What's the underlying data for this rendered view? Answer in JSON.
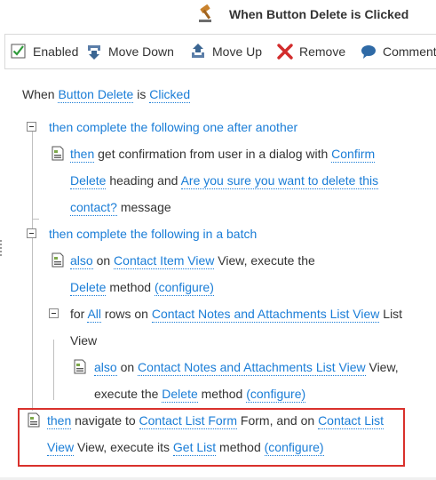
{
  "header": {
    "title": "When Button Delete is Clicked",
    "icon": "gavel-icon"
  },
  "toolbar": {
    "enabled_label": "Enabled",
    "move_down_label": "Move Down",
    "move_up_label": "Move Up",
    "remove_label": "Remove",
    "comment_label": "Comment"
  },
  "rule": {
    "when": {
      "prefix": "When",
      "control": "Button Delete",
      "is": "is",
      "event": "Clicked"
    },
    "seq_group": {
      "label": "then complete the following one after another"
    },
    "confirm": {
      "then": "then",
      "text1": "get confirmation from user in a dialog with",
      "heading_link_1": "Confirm",
      "heading_link_2": "Delete",
      "text2": "heading and",
      "message_link_1": "Are you sure you want to delete this",
      "message_link_2": "contact?",
      "text3": "message"
    },
    "batch_group": {
      "label": "then complete the following in a batch"
    },
    "batch_action": {
      "also": "also",
      "on": "on",
      "view_link": "Contact Item View",
      "text1": "View, execute the",
      "method_link": "Delete",
      "text2": "method",
      "configure": "(configure)"
    },
    "for_each": {
      "for": "for",
      "all": "All",
      "rows_on": "rows on",
      "list_link": "Contact Notes and Attachments List View",
      "text1": "List",
      "text2": "View"
    },
    "for_action": {
      "also": "also",
      "on": "on",
      "view_link": "Contact Notes and Attachments List View",
      "text1": "View,",
      "text2": "execute the",
      "method_link": "Delete",
      "text3": "method",
      "configure": "(configure)"
    },
    "navigate_action": {
      "then": "then",
      "text1": "navigate to",
      "form_link": "Contact List Form",
      "text2": "Form, and on",
      "view_link_1": "Contact List",
      "view_link_2": "View",
      "text3": "View, execute its",
      "method_link": "Get List",
      "text4": "method",
      "configure": "(configure)"
    }
  },
  "colors": {
    "link": "#1a7dd7",
    "highlight_border": "#d9312c",
    "remove_red": "#d22c2c"
  }
}
